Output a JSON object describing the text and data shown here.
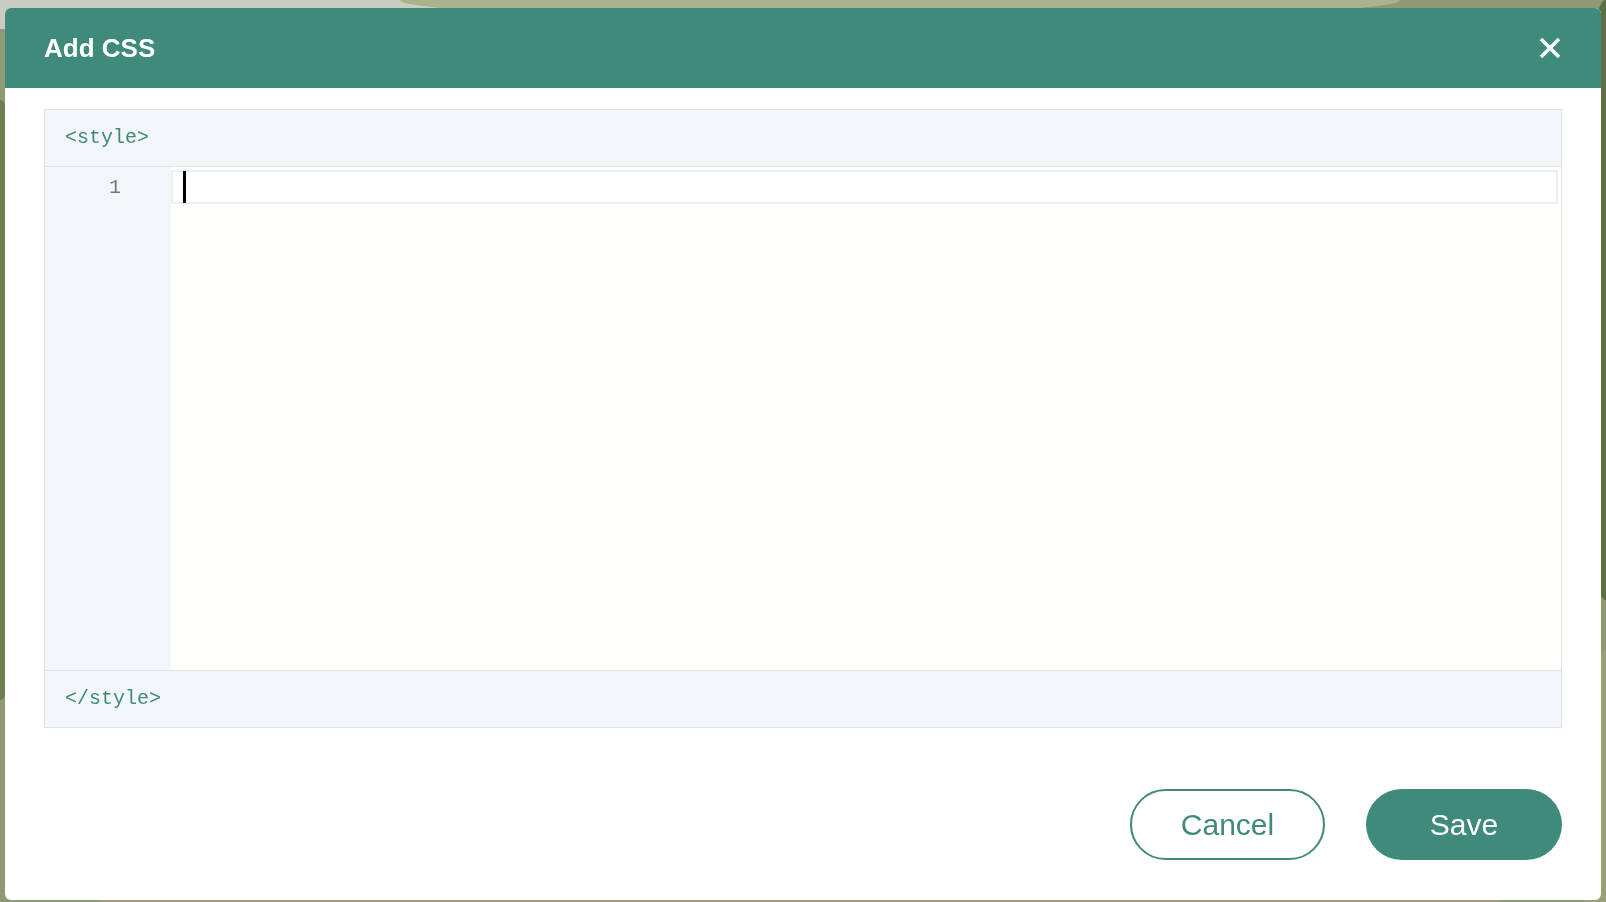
{
  "dialog": {
    "title": "Add CSS"
  },
  "editor": {
    "open_tag": "<style>",
    "lines": [
      {
        "number": "1",
        "active": true
      }
    ],
    "close_tag": "</style>"
  },
  "buttons": [
    {
      "label": "Cancel",
      "kind": "secondary"
    },
    {
      "label": "Save",
      "kind": "primary"
    }
  ]
}
